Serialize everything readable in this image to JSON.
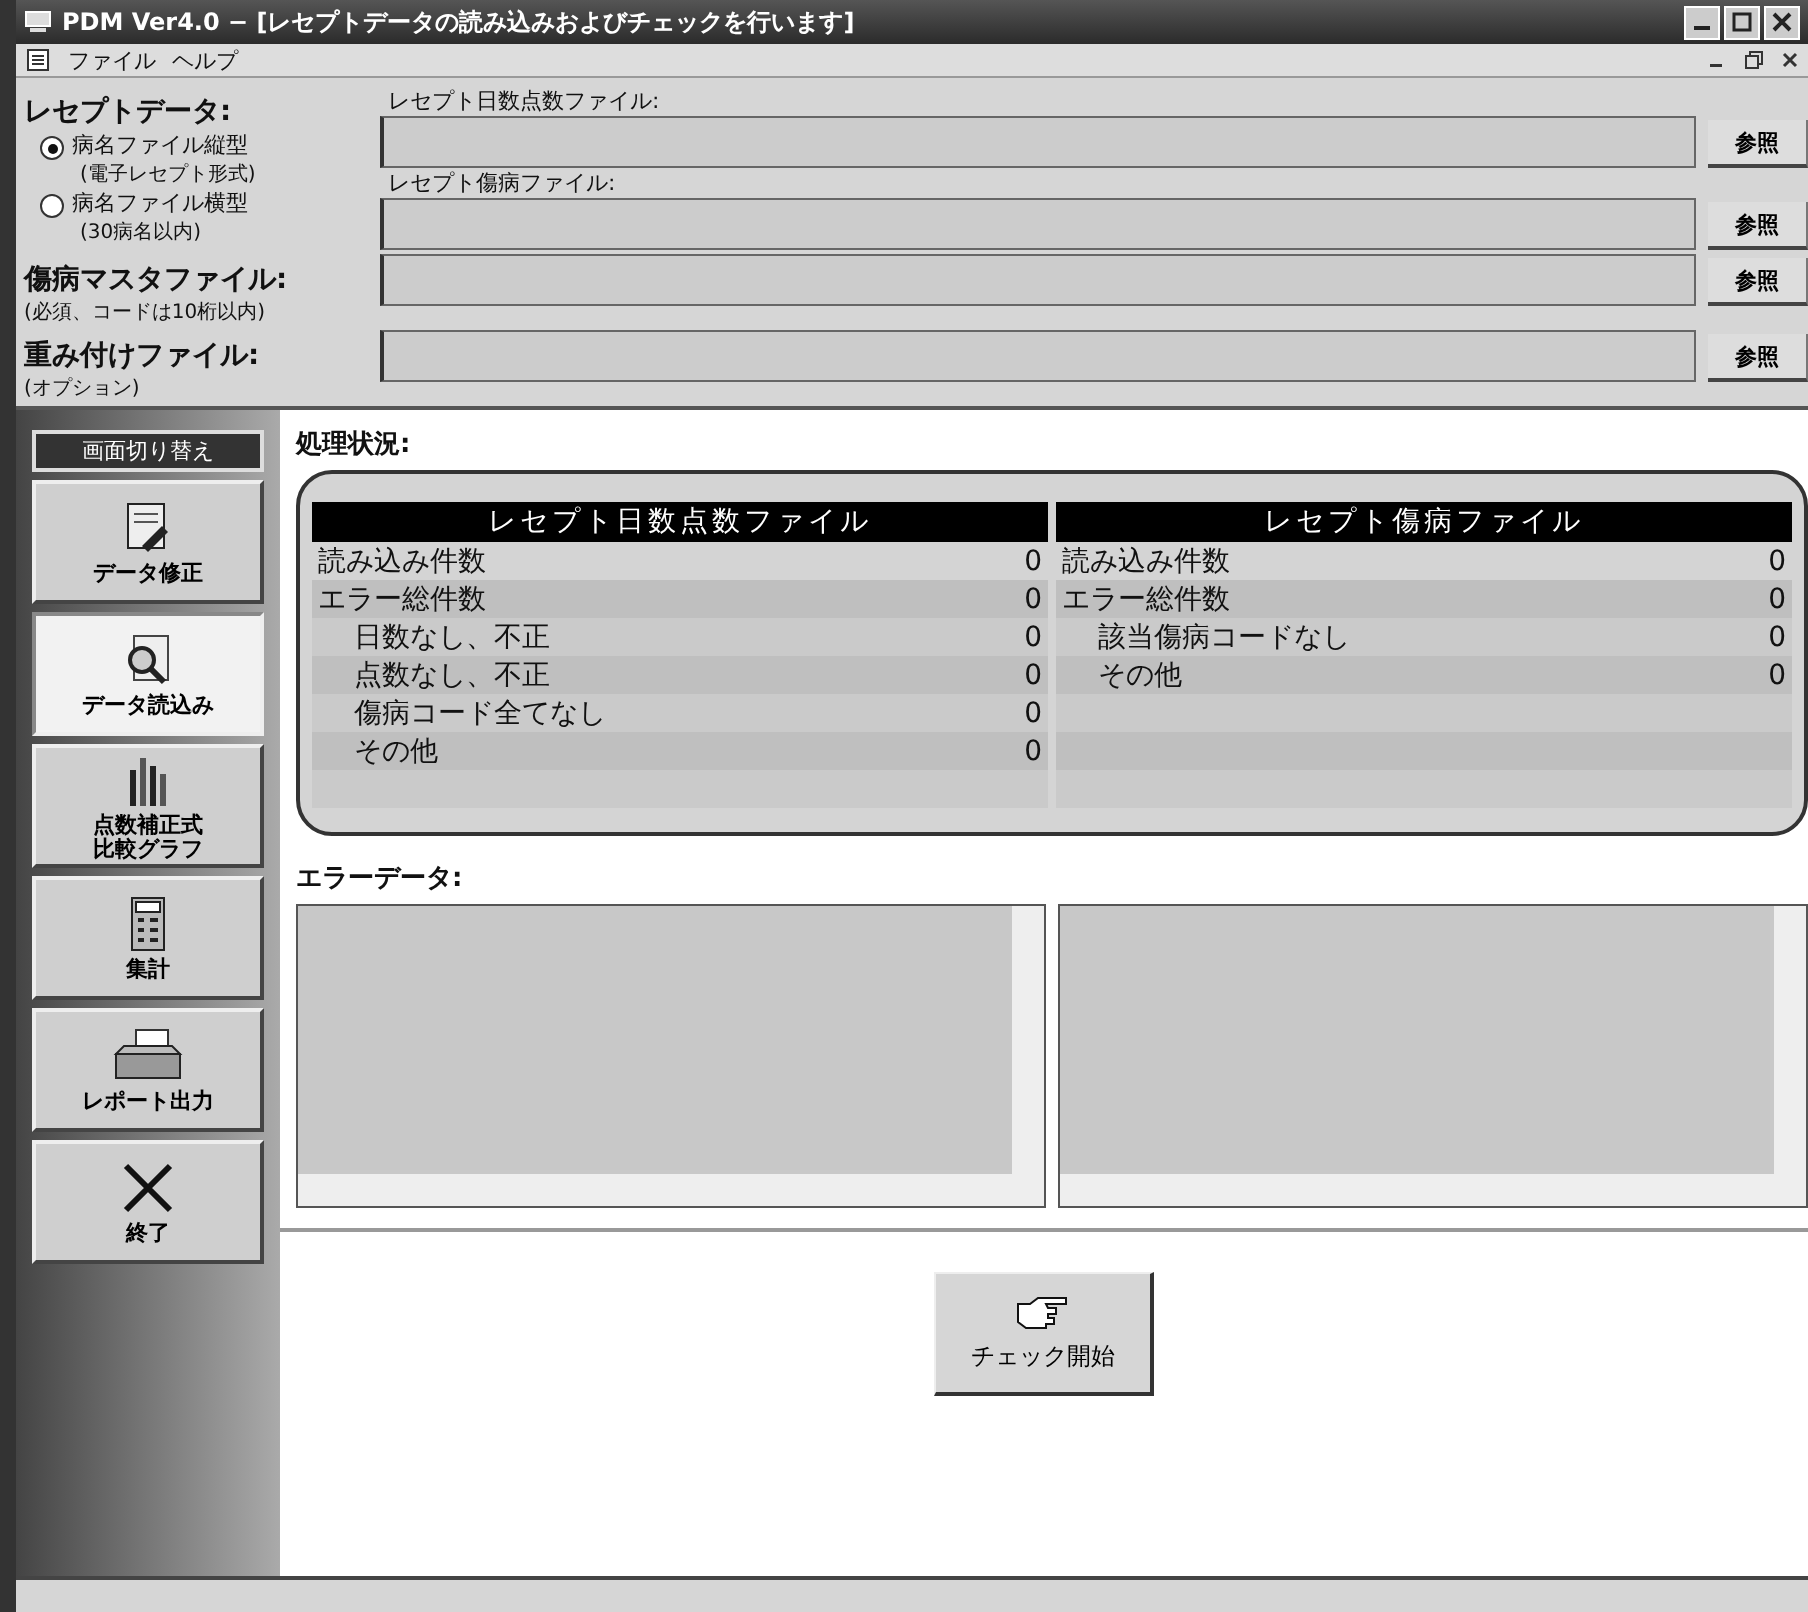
{
  "window": {
    "title": "PDM Ver4.0 − [レセプトデータの読み込みおよびチェックを行います]"
  },
  "menu": [
    {
      "label": "ファイル"
    },
    {
      "label": "ヘルプ"
    }
  ],
  "receipt_data": {
    "label": "レセプトデータ:",
    "options": [
      {
        "label": "病名ファイル縦型",
        "note": "(電子レセプト形式)",
        "selected": true
      },
      {
        "label": "病名ファイル横型",
        "note": "(30病名以内)",
        "selected": false
      }
    ],
    "fields": [
      {
        "label": "レセプト日数点数ファイル:",
        "button": "参照"
      },
      {
        "label": "レセプト傷病ファイル:",
        "button": "参照"
      }
    ]
  },
  "files": [
    {
      "label": "傷病マスタファイル:",
      "note": "(必須、コードは10桁以内)",
      "button": "参照"
    },
    {
      "label": "重み付けファイル:",
      "note": "(オプション)",
      "button": "参照"
    }
  ],
  "sidebar": {
    "header": "画面切り替え",
    "items": [
      {
        "kind": "edit",
        "label": "データ修正",
        "selected": false
      },
      {
        "kind": "read",
        "label": "データ読込み",
        "selected": true
      },
      {
        "kind": "chart",
        "label": [
          "点数補正式",
          "比較グラフ"
        ],
        "selected": false
      },
      {
        "kind": "calc",
        "label": "集計",
        "selected": false
      },
      {
        "kind": "print",
        "label": "レポート出力",
        "selected": false
      },
      {
        "kind": "exit",
        "label": "終了",
        "selected": false
      }
    ]
  },
  "status_heading": "処理状況:",
  "tables": [
    {
      "title": "レセプト日数点数ファイル",
      "rows": [
        {
          "label": "読み込み件数",
          "value": "0"
        },
        {
          "label": "エラー総件数",
          "value": "0",
          "children": [
            {
              "label": "日数なし、不正",
              "value": "0"
            },
            {
              "label": "点数なし、不正",
              "value": "0"
            },
            {
              "label": "傷病コード全てなし",
              "value": "0"
            },
            {
              "label": "その他",
              "value": "0"
            }
          ]
        }
      ]
    },
    {
      "title": "レセプト傷病ファイル",
      "rows": [
        {
          "label": "読み込み件数",
          "value": "0"
        },
        {
          "label": "エラー総件数",
          "value": "0",
          "children": [
            {
              "label": "該当傷病コードなし",
              "value": "0"
            },
            {
              "label": "その他",
              "value": "0"
            }
          ]
        }
      ]
    }
  ],
  "error_heading": "エラーデータ:",
  "check_button": "チェック開始"
}
